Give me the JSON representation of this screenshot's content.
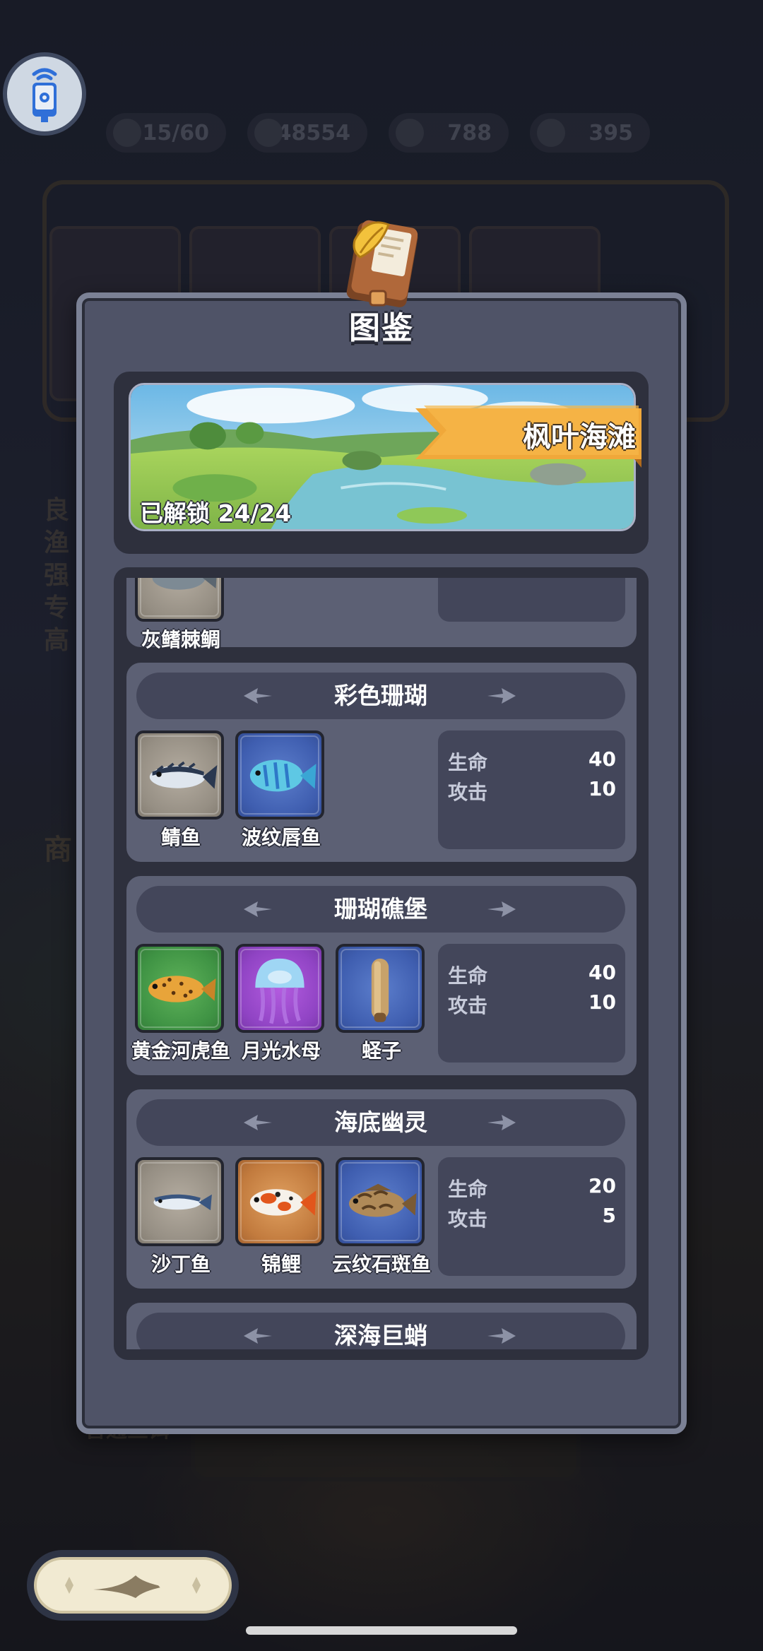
{
  "hud": {
    "slots": "15/60",
    "coins": "548554",
    "pearls": "788",
    "hooks": "395"
  },
  "background": {
    "left_text": "良渔强专高",
    "shop_label": "商",
    "bait_label": "普通鱼饵"
  },
  "dialog": {
    "title": "图鉴",
    "area_name": "枫叶海滩",
    "unlock_text": "已解锁 24/24"
  },
  "partial_group": {
    "fish_name": "灰鳍棘鲷"
  },
  "groups": [
    {
      "title": "彩色珊瑚",
      "fish": [
        {
          "name": "鲭鱼",
          "rarity": "gray"
        },
        {
          "name": "波纹唇鱼",
          "rarity": "blue"
        }
      ],
      "stats": {
        "hp_label": "生命",
        "hp": "40",
        "atk_label": "攻击",
        "atk": "10"
      }
    },
    {
      "title": "珊瑚礁堡",
      "fish": [
        {
          "name": "黄金河虎鱼",
          "rarity": "green"
        },
        {
          "name": "月光水母",
          "rarity": "purple"
        },
        {
          "name": "蛏子",
          "rarity": "blue"
        }
      ],
      "stats": {
        "hp_label": "生命",
        "hp": "40",
        "atk_label": "攻击",
        "atk": "10"
      }
    },
    {
      "title": "海底幽灵",
      "fish": [
        {
          "name": "沙丁鱼",
          "rarity": "gray"
        },
        {
          "name": "锦鲤",
          "rarity": "orange"
        },
        {
          "name": "云纹石斑鱼",
          "rarity": "blue"
        }
      ],
      "stats": {
        "hp_label": "生命",
        "hp": "20",
        "atk_label": "攻击",
        "atk": "5"
      }
    },
    {
      "title": "深海巨蛸"
    }
  ],
  "icons": {
    "avatar": "phone-signal-icon",
    "book": "encyclopedia-book-icon",
    "fin": "fish-fin-icon",
    "bottom": "fishing-boat-icon"
  }
}
